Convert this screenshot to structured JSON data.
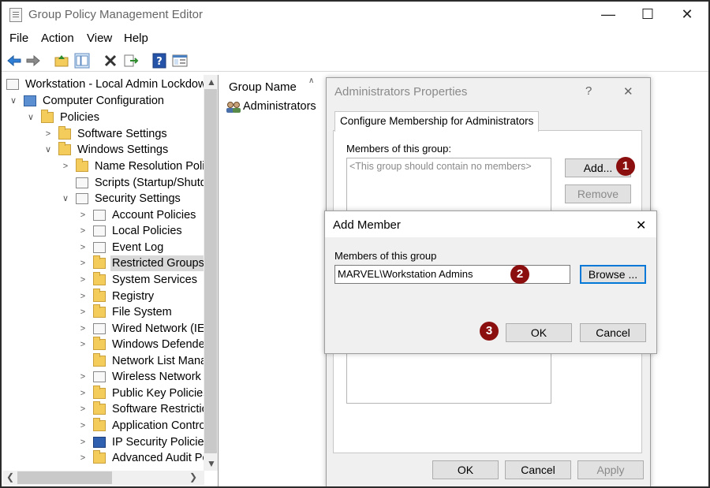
{
  "window": {
    "title": "Group Policy Management Editor",
    "minimize": "—",
    "maximize": "☐",
    "close": "✕"
  },
  "menu": [
    "File",
    "Action",
    "View",
    "Help"
  ],
  "tree": {
    "root": "Workstation - Local Admin Lockdow",
    "computer_configuration": "Computer Configuration",
    "policies": "Policies",
    "software_settings": "Software Settings",
    "windows_settings": "Windows Settings",
    "name_resolution": "Name Resolution Polic",
    "scripts": "Scripts (Startup/Shutdc",
    "security_settings": "Security Settings",
    "items": [
      "Account Policies",
      "Local Policies",
      "Event Log",
      "Restricted Groups",
      "System Services",
      "Registry",
      "File System",
      "Wired Network (IEE",
      "Windows Defender",
      "Network List Mana",
      "Wireless Network (",
      "Public Key Policies",
      "Software Restrictio",
      "Application Contro",
      "IP Security Policies",
      "Advanced Audit Po"
    ]
  },
  "list": {
    "column_header": "Group Name",
    "rows": [
      "Administrators"
    ]
  },
  "properties_dialog": {
    "title": "Administrators Properties",
    "help": "?",
    "close": "✕",
    "tab": "Configure Membership for Administrators",
    "members_label": "Members of this group:",
    "members_placeholder": "<This group should contain no members>",
    "add": "Add...",
    "remove": "Remove",
    "ok": "OK",
    "cancel": "Cancel",
    "apply": "Apply"
  },
  "add_member_dialog": {
    "title": "Add Member",
    "close": "✕",
    "field_label": "Members of this group",
    "field_value": "MARVEL\\Workstation Admins",
    "browse": "Browse ...",
    "ok": "OK",
    "cancel": "Cancel"
  },
  "callouts": [
    "1",
    "2",
    "3"
  ],
  "colors": {
    "callout": "#8b0f0f",
    "focus_border": "#0078d7",
    "folder": "#f3cc5b"
  }
}
